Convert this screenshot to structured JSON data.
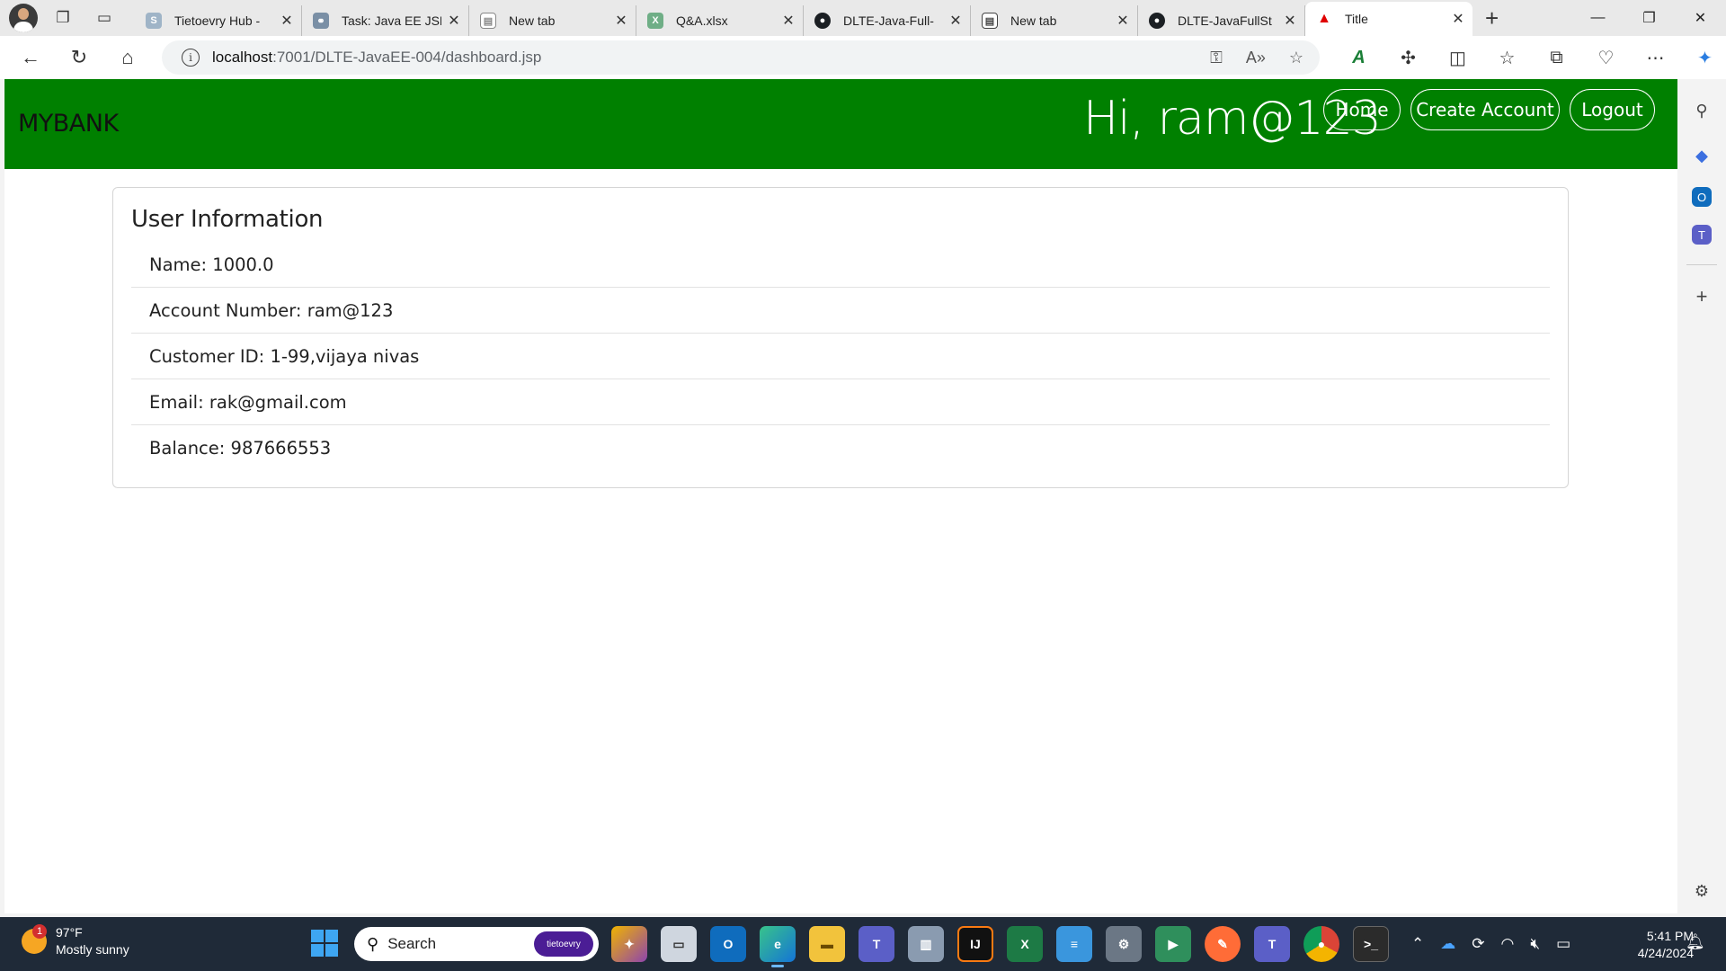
{
  "browser": {
    "tabs": [
      {
        "title": "Tietoevry Hub -",
        "favicon": "sharepoint-icon",
        "color": "#9fb4c7",
        "active": false
      },
      {
        "title": "Task: Java EE JSP",
        "favicon": "link-icon",
        "color": "#7a8fa5",
        "active": false
      },
      {
        "title": "New tab",
        "favicon": "newtab-icon",
        "color": "#8a8a8a",
        "active": false
      },
      {
        "title": "Q&A.xlsx",
        "favicon": "excel-icon",
        "color": "#6fae86",
        "active": false
      },
      {
        "title": "DLTE-Java-Full-",
        "favicon": "github-icon",
        "color": "#1b1f23",
        "active": false
      },
      {
        "title": "New tab",
        "favicon": "newtab-icon",
        "color": "#444444",
        "active": false
      },
      {
        "title": "DLTE-JavaFullSt",
        "favicon": "github-icon",
        "color": "#1b1f23",
        "active": false
      },
      {
        "title": "Title",
        "favicon": "redhat-icon",
        "color": "#e00000",
        "active": true
      }
    ],
    "url_host": "localhost",
    "url_path": ":7001/DLTE-JavaEE-004/dashboard.jsp"
  },
  "page": {
    "brand": "MYBANK",
    "greeting": "Hi, ram@123",
    "nav": {
      "home": "Home",
      "create_account": "Create Account",
      "logout": "Logout"
    },
    "card_title": "User Information",
    "fields": [
      "Name: 1000.0",
      "Account Number: ram@123",
      "Customer ID: 1-99,vijaya nivas",
      "Email: rak@gmail.com",
      "Balance: 987666553"
    ],
    "navbar_color": "#008000"
  },
  "taskbar": {
    "weather_temp": "97°F",
    "weather_desc": "Mostly sunny",
    "weather_badge": "1",
    "search_placeholder": "Search",
    "search_badge": "tietoevry",
    "time": "5:41 PM",
    "date": "4/24/2024"
  }
}
